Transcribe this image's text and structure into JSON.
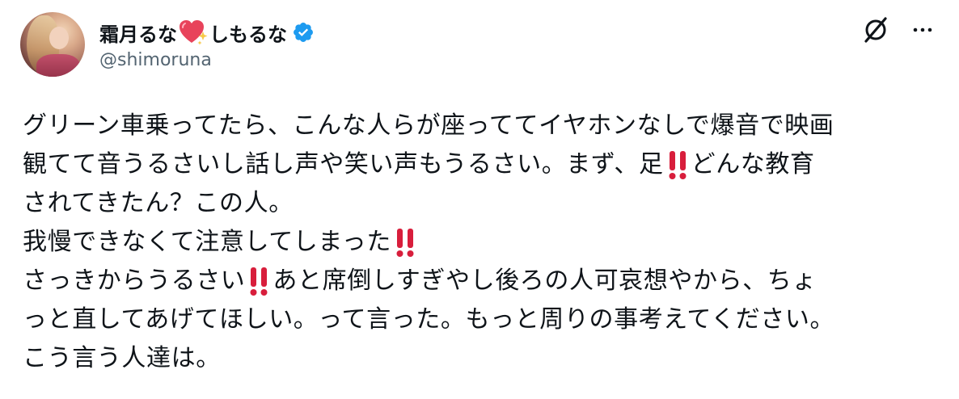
{
  "author": {
    "name_part1": "霜月るな",
    "name_part2": "しもるな",
    "handle": "@shimoruna",
    "heart_emoji": "sparkling-heart",
    "verified": true
  },
  "actions": {
    "grok_icon": "grok-icon",
    "more_icon": "more-dots-icon"
  },
  "tweet": {
    "line1": "グリーン車乗ってたら、こんな人らが座っててイヤホンなしで爆音で映画",
    "line2a": "観てて音うるさいし話し声や笑い声もうるさい。まず、足",
    "line2b": "どんな教育",
    "line3": "されてきたん？この人。",
    "line4": "我慢できなくて注意してしまった",
    "line5a": "さっきからうるさい",
    "line5b": "あと席倒しすぎやし後ろの人可哀想やから、ちょ",
    "line6": "っと直してあげてほしい。って言った。もっと周りの事考えてください。",
    "line7": "こう言う人達は。"
  },
  "colors": {
    "text": "#0f1419",
    "handle": "#536471",
    "verified_blue": "#1d9bf0",
    "emoji_red": "#d81e3c"
  }
}
